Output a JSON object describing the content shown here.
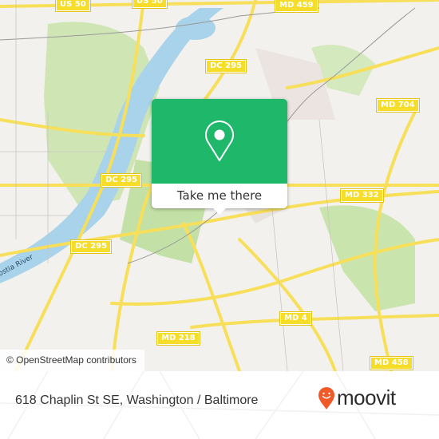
{
  "map": {
    "attribution": "© OpenStreetMap contributors",
    "river_label": "ostia River",
    "route_shields": [
      {
        "label": "US 50",
        "pos": "top-left"
      },
      {
        "label": "US 50",
        "pos": "top-center"
      },
      {
        "label": "MD 459",
        "pos": "top-right"
      },
      {
        "label": "DC 295",
        "pos": "upper-center"
      },
      {
        "label": "MD 704",
        "pos": "upper-right"
      },
      {
        "label": "DC 295",
        "pos": "middle-left"
      },
      {
        "label": "MD 332",
        "pos": "middle-right"
      },
      {
        "label": "DC 295",
        "pos": "lower-left"
      },
      {
        "label": "MD 4",
        "pos": "lower-right"
      },
      {
        "label": "MD 218",
        "pos": "lower-center"
      },
      {
        "label": "MD 458",
        "pos": "bottom-right"
      }
    ]
  },
  "popup": {
    "icon": "map-pin-icon",
    "button_label": "Take me there",
    "color": "#1fb86b"
  },
  "footer": {
    "address": "618 Chaplin St SE, Washington / Baltimore",
    "brand": "moovit",
    "brand_color": "#f05a28"
  }
}
